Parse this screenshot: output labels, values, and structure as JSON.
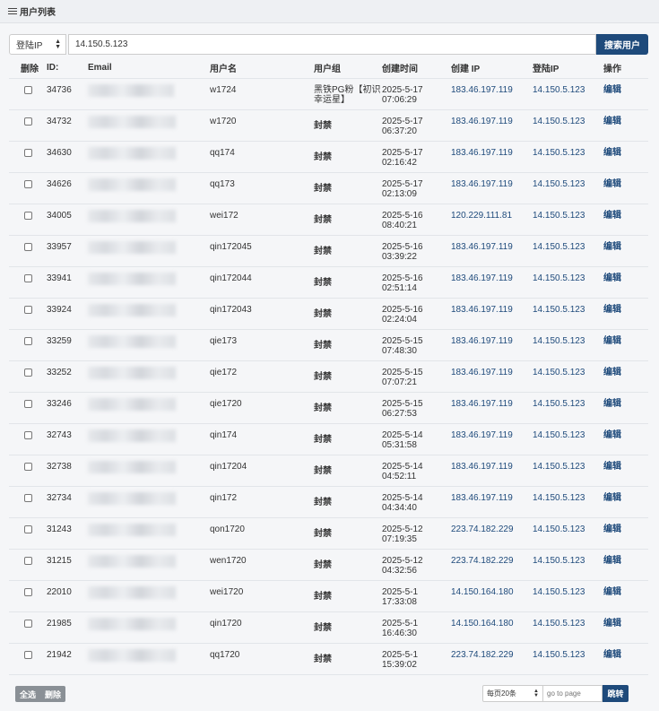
{
  "header": {
    "title": "用户列表"
  },
  "search": {
    "field": "登陆IP",
    "value": "14.150.5.123",
    "button": "搜索用户"
  },
  "columns": [
    "删除",
    "ID:",
    "Email",
    "用户名",
    "用户组",
    "创建时间",
    "创建 IP",
    "登陆IP",
    "操作"
  ],
  "rows": [
    {
      "id": "34736",
      "username": "w1724",
      "group": "黑铁PG粉【初识幸运星】",
      "date": "2025-5-17",
      "time": "07:06:29",
      "create_ip": "183.46.197.119",
      "login_ip": "14.150.5.123",
      "action": "编辑"
    },
    {
      "id": "34732",
      "username": "w1720",
      "group": "封禁",
      "date": "2025-5-17",
      "time": "06:37:20",
      "create_ip": "183.46.197.119",
      "login_ip": "14.150.5.123",
      "action": "编辑"
    },
    {
      "id": "34630",
      "username": "qq174",
      "group": "封禁",
      "date": "2025-5-17",
      "time": "02:16:42",
      "create_ip": "183.46.197.119",
      "login_ip": "14.150.5.123",
      "action": "编辑"
    },
    {
      "id": "34626",
      "username": "qq173",
      "group": "封禁",
      "date": "2025-5-17",
      "time": "02:13:09",
      "create_ip": "183.46.197.119",
      "login_ip": "14.150.5.123",
      "action": "编辑"
    },
    {
      "id": "34005",
      "username": "wei172",
      "group": "封禁",
      "date": "2025-5-16",
      "time": "08:40:21",
      "create_ip": "120.229.111.81",
      "login_ip": "14.150.5.123",
      "action": "编辑"
    },
    {
      "id": "33957",
      "username": "qin172045",
      "group": "封禁",
      "date": "2025-5-16",
      "time": "03:39:22",
      "create_ip": "183.46.197.119",
      "login_ip": "14.150.5.123",
      "action": "编辑"
    },
    {
      "id": "33941",
      "username": "qin172044",
      "group": "封禁",
      "date": "2025-5-16",
      "time": "02:51:14",
      "create_ip": "183.46.197.119",
      "login_ip": "14.150.5.123",
      "action": "编辑"
    },
    {
      "id": "33924",
      "username": "qin172043",
      "group": "封禁",
      "date": "2025-5-16",
      "time": "02:24:04",
      "create_ip": "183.46.197.119",
      "login_ip": "14.150.5.123",
      "action": "编辑"
    },
    {
      "id": "33259",
      "username": "qie173",
      "group": "封禁",
      "date": "2025-5-15",
      "time": "07:48:30",
      "create_ip": "183.46.197.119",
      "login_ip": "14.150.5.123",
      "action": "编辑"
    },
    {
      "id": "33252",
      "username": "qie172",
      "group": "封禁",
      "date": "2025-5-15",
      "time": "07:07:21",
      "create_ip": "183.46.197.119",
      "login_ip": "14.150.5.123",
      "action": "编辑"
    },
    {
      "id": "33246",
      "username": "qie1720",
      "group": "封禁",
      "date": "2025-5-15",
      "time": "06:27:53",
      "create_ip": "183.46.197.119",
      "login_ip": "14.150.5.123",
      "action": "编辑"
    },
    {
      "id": "32743",
      "username": "qin174",
      "group": "封禁",
      "date": "2025-5-14",
      "time": "05:31:58",
      "create_ip": "183.46.197.119",
      "login_ip": "14.150.5.123",
      "action": "编辑"
    },
    {
      "id": "32738",
      "username": "qin17204",
      "group": "封禁",
      "date": "2025-5-14",
      "time": "04:52:11",
      "create_ip": "183.46.197.119",
      "login_ip": "14.150.5.123",
      "action": "编辑"
    },
    {
      "id": "32734",
      "username": "qin172",
      "group": "封禁",
      "date": "2025-5-14",
      "time": "04:34:40",
      "create_ip": "183.46.197.119",
      "login_ip": "14.150.5.123",
      "action": "编辑"
    },
    {
      "id": "31243",
      "username": "qon1720",
      "group": "封禁",
      "date": "2025-5-12",
      "time": "07:19:35",
      "create_ip": "223.74.182.229",
      "login_ip": "14.150.5.123",
      "action": "编辑"
    },
    {
      "id": "31215",
      "username": "wen1720",
      "group": "封禁",
      "date": "2025-5-12",
      "time": "04:32:56",
      "create_ip": "223.74.182.229",
      "login_ip": "14.150.5.123",
      "action": "编辑"
    },
    {
      "id": "22010",
      "username": "wei1720",
      "group": "封禁",
      "date": "2025-5-1",
      "time": "17:33:08",
      "create_ip": "14.150.164.180",
      "login_ip": "14.150.5.123",
      "action": "编辑"
    },
    {
      "id": "21985",
      "username": "qin1720",
      "group": "封禁",
      "date": "2025-5-1",
      "time": "16:46:30",
      "create_ip": "14.150.164.180",
      "login_ip": "14.150.5.123",
      "action": "编辑"
    },
    {
      "id": "21942",
      "username": "qq1720",
      "group": "封禁",
      "date": "2025-5-1",
      "time": "15:39:02",
      "create_ip": "223.74.182.229",
      "login_ip": "14.150.5.123",
      "action": "编辑"
    }
  ],
  "footer": {
    "select_all": "全选",
    "delete": "删除",
    "per_page": "每页20条",
    "goto_placeholder": "go to page",
    "jump": "跳转"
  },
  "colors": {
    "accent": "#1e4a7b",
    "gray_button": "#8a9096"
  }
}
